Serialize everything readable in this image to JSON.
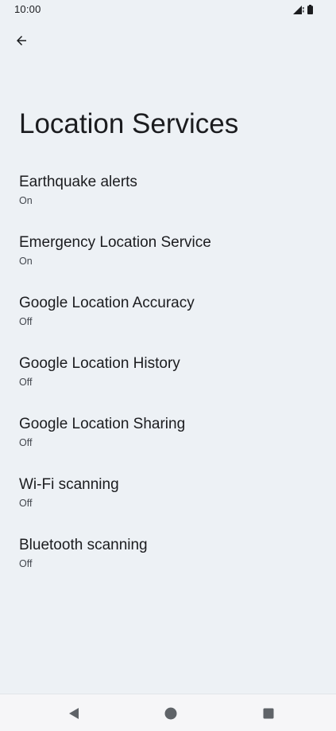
{
  "status_bar": {
    "time": "10:00",
    "icons": [
      "signal-icon",
      "battery-icon"
    ]
  },
  "app_bar": {
    "back_icon": "arrow-back-icon"
  },
  "page": {
    "title": "Location Services"
  },
  "settings": [
    {
      "title": "Earthquake alerts",
      "summary": "On"
    },
    {
      "title": "Emergency Location Service",
      "summary": "On"
    },
    {
      "title": "Google Location Accuracy",
      "summary": "Off"
    },
    {
      "title": "Google Location History",
      "summary": "Off"
    },
    {
      "title": "Google Location Sharing",
      "summary": "Off"
    },
    {
      "title": "Wi-Fi scanning",
      "summary": "Off"
    },
    {
      "title": "Bluetooth scanning",
      "summary": "Off"
    }
  ],
  "nav_bar": {
    "buttons": [
      "nav-back-icon",
      "nav-home-icon",
      "nav-recents-icon"
    ]
  },
  "colors": {
    "background": "#edf1f5",
    "text_primary": "#1b1c1f",
    "text_secondary": "#43474e",
    "nav_icon": "#5f6368"
  }
}
